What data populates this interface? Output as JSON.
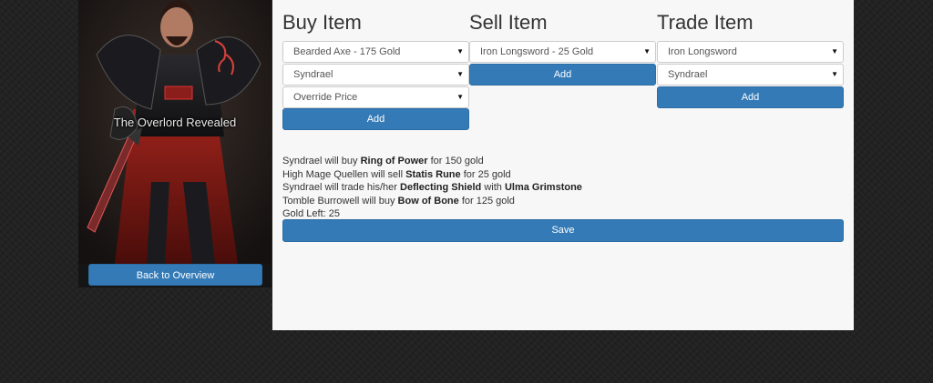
{
  "card": {
    "title": "The Overlord Revealed",
    "back_label": "Back to Overview"
  },
  "buy": {
    "heading": "Buy Item",
    "item_select": "Bearded Axe - 175 Gold",
    "hero_select": "Syndrael",
    "price_select": "Override Price",
    "add_label": "Add"
  },
  "sell": {
    "heading": "Sell Item",
    "item_select": "Iron Longsword - 25 Gold",
    "add_label": "Add"
  },
  "trade": {
    "heading": "Trade Item",
    "item_select": "Iron Longsword",
    "hero_select": "Syndrael",
    "add_label": "Add"
  },
  "log": {
    "entries": [
      {
        "pre": "Syndrael will buy ",
        "item": "Ring of Power",
        "post": " for 150 gold"
      },
      {
        "pre": "High Mage Quellen will sell ",
        "item": "Statis Rune",
        "post": " for 25 gold"
      },
      {
        "pre": "Syndrael will trade his/her ",
        "item": "Deflecting Shield",
        "post": " with ",
        "target": "Ulma Grimstone"
      },
      {
        "pre": "Tomble Burrowell will buy ",
        "item": "Bow of Bone",
        "post": " for 125 gold"
      }
    ],
    "gold_left": "Gold Left: 25"
  },
  "save_label": "Save",
  "caret": "▼"
}
